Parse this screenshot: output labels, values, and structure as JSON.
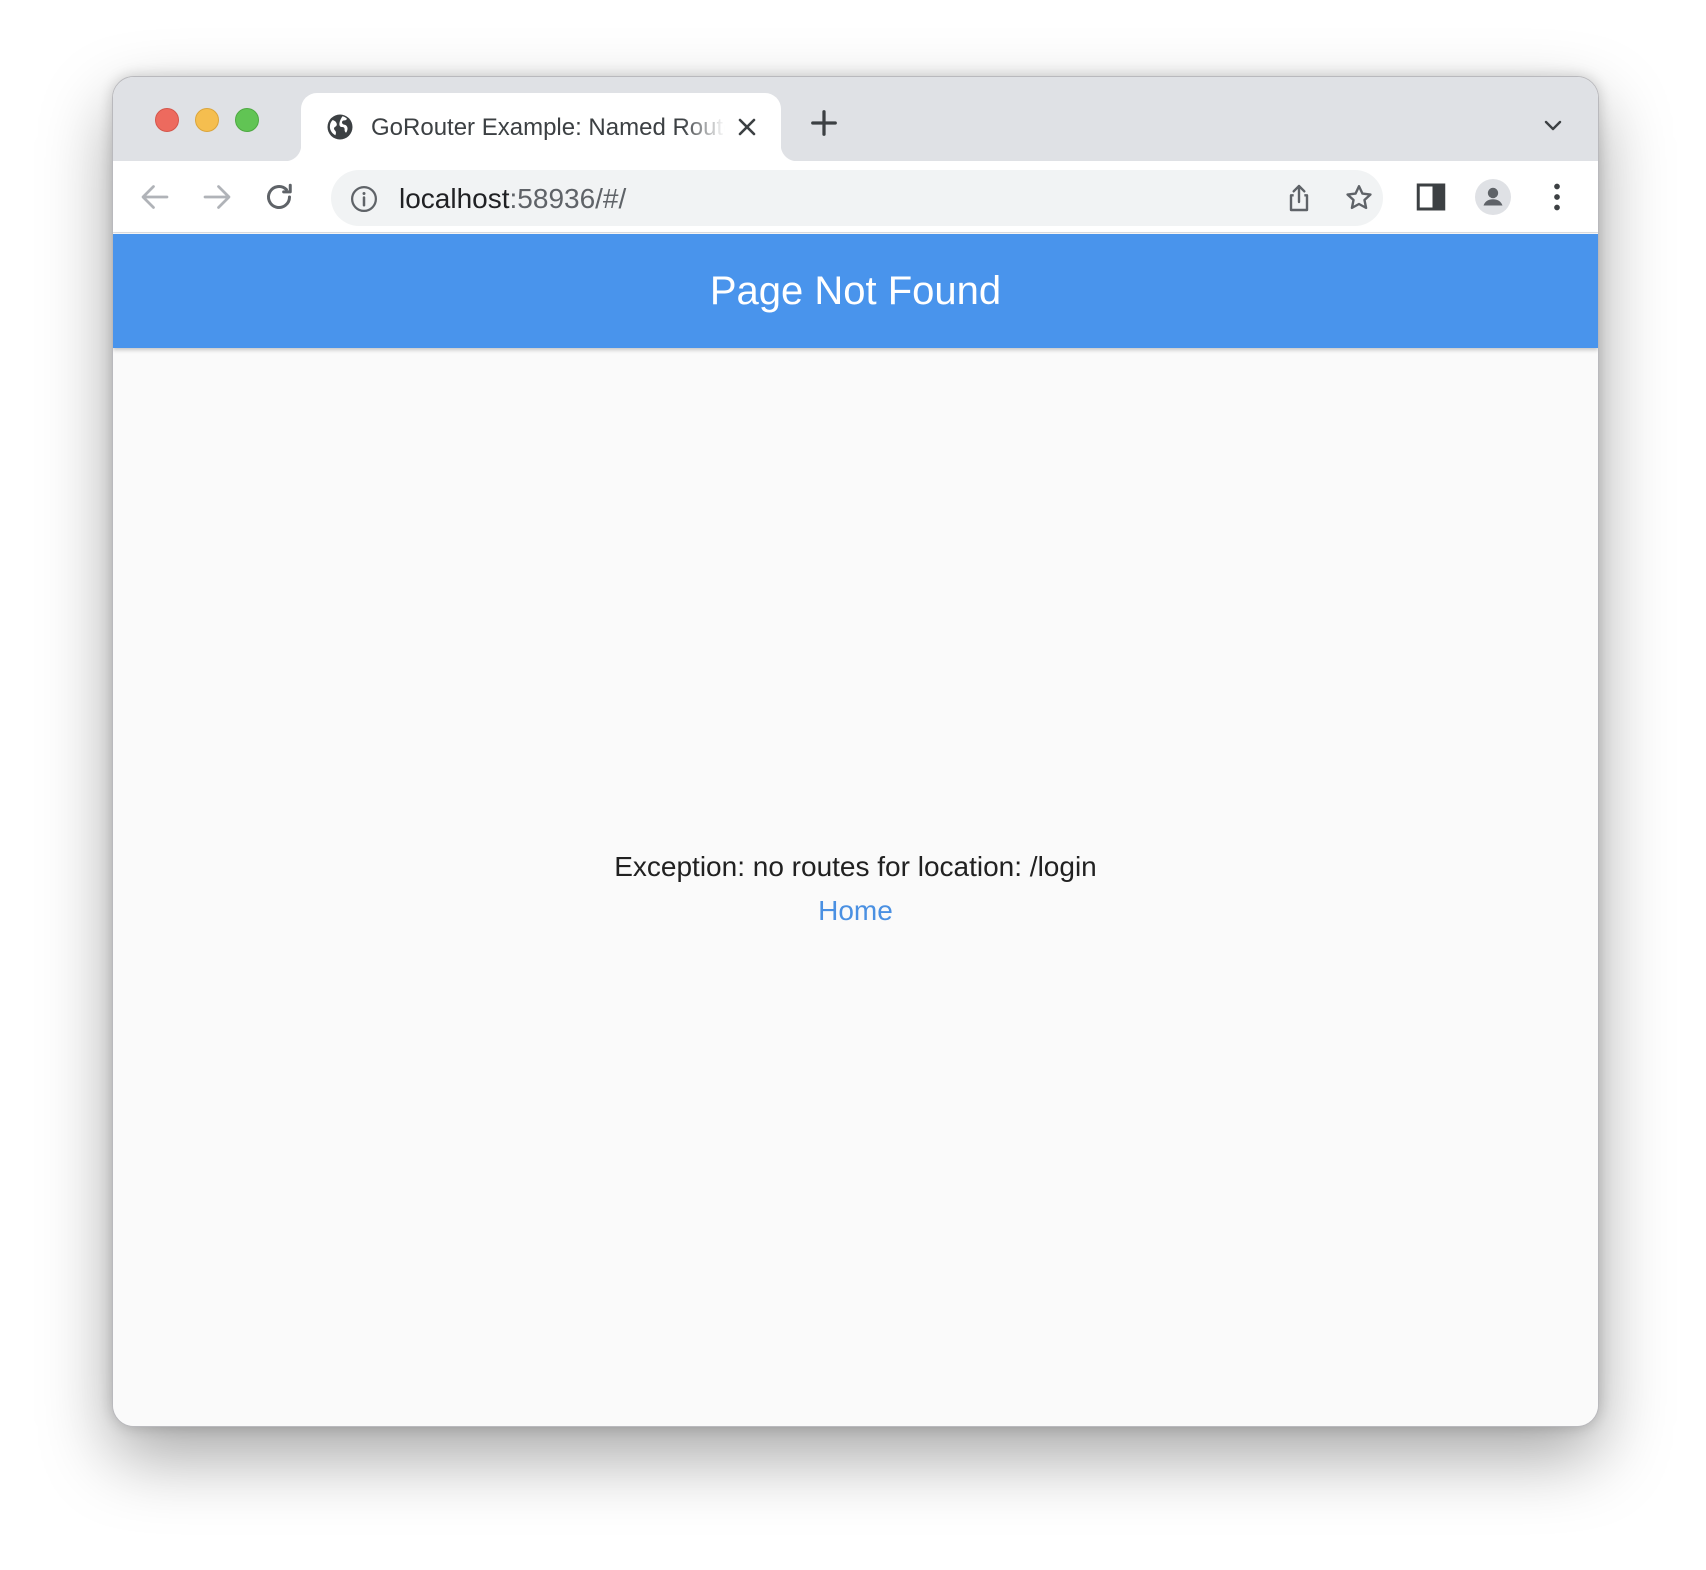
{
  "browser": {
    "tab": {
      "title": "GoRouter Example: Named Routes",
      "favicon": "globe-icon",
      "close_icon": "close-icon"
    },
    "new_tab_icon": "plus-icon",
    "tab_search_icon": "chevron-down-icon",
    "toolbar": {
      "back_icon": "arrow-left-icon",
      "forward_icon": "arrow-right-icon",
      "reload_icon": "reload-icon",
      "site_info_icon": "info-icon",
      "url_host": "localhost",
      "url_rest": ":58936/#/",
      "share_icon": "share-icon",
      "bookmark_icon": "star-icon",
      "side_panel_icon": "side-panel-icon",
      "profile_icon": "person-icon",
      "menu_icon": "more-vert-icon"
    },
    "traffic_lights": {
      "close_color": "#ed6a5e",
      "minimize_color": "#f5be4f",
      "zoom_color": "#61c454"
    }
  },
  "app": {
    "appbar_title": "Page Not Found",
    "appbar_color": "#4994ec",
    "error_message": "Exception: no routes for location: /login",
    "home_link_label": "Home",
    "link_color": "#4a90e2"
  }
}
